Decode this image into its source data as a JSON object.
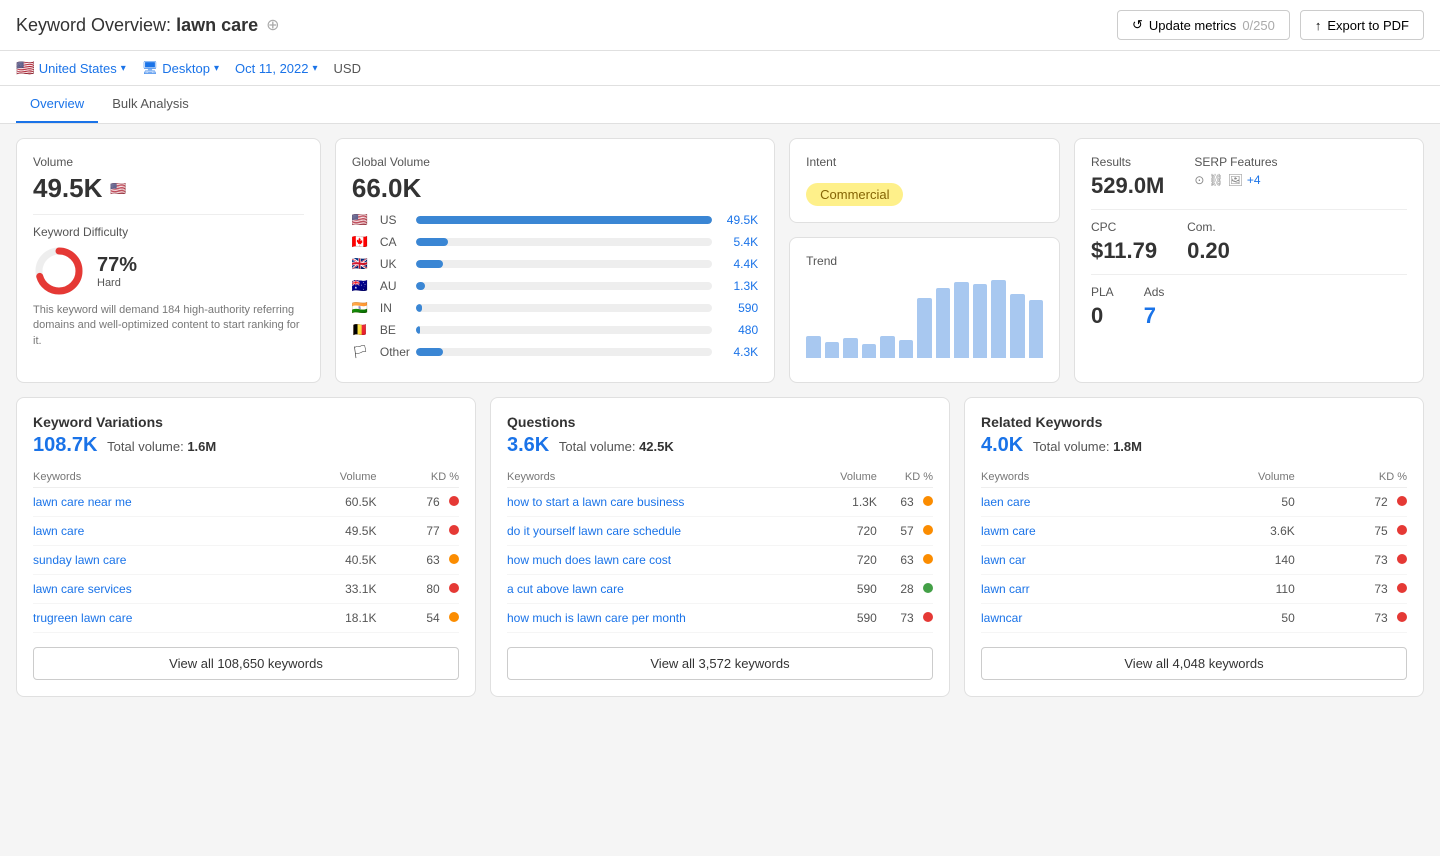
{
  "header": {
    "title": "Keyword Overview:",
    "keyword": "lawn care",
    "update_btn": "Update metrics",
    "update_count": "0/250",
    "export_btn": "Export to PDF"
  },
  "filters": {
    "country": "United States",
    "device": "Desktop",
    "date": "Oct 11, 2022",
    "currency": "USD"
  },
  "tabs": [
    {
      "label": "Overview",
      "active": true
    },
    {
      "label": "Bulk Analysis",
      "active": false
    }
  ],
  "volume_card": {
    "label": "Volume",
    "value": "49.5K",
    "kd_label": "Keyword Difficulty",
    "kd_percent": "77%",
    "kd_level": "Hard",
    "kd_desc": "This keyword will demand 184 high-authority referring domains and well-optimized content to start ranking for it."
  },
  "global_volume_card": {
    "label": "Global Volume",
    "value": "66.0K",
    "countries": [
      {
        "flag": "🇺🇸",
        "code": "US",
        "bar_pct": 100,
        "val": "49.5K"
      },
      {
        "flag": "🇨🇦",
        "code": "CA",
        "bar_pct": 11,
        "val": "5.4K"
      },
      {
        "flag": "🇬🇧",
        "code": "UK",
        "bar_pct": 9,
        "val": "4.4K"
      },
      {
        "flag": "🇦🇺",
        "code": "AU",
        "bar_pct": 3,
        "val": "1.3K"
      },
      {
        "flag": "🇮🇳",
        "code": "IN",
        "bar_pct": 2,
        "val": "590"
      },
      {
        "flag": "🇧🇪",
        "code": "BE",
        "bar_pct": 1.5,
        "val": "480"
      },
      {
        "flag": "🏳",
        "code": "Other",
        "bar_pct": 9,
        "val": "4.3K"
      }
    ]
  },
  "intent_card": {
    "label": "Intent",
    "badge": "Commercial",
    "trend_label": "Trend",
    "trend_bars": [
      20,
      15,
      18,
      14,
      20,
      16,
      55,
      65,
      70,
      68,
      72,
      60,
      55
    ]
  },
  "results_card": {
    "results_label": "Results",
    "results_value": "529.0M",
    "serp_label": "SERP Features",
    "serp_icons": [
      "⊙",
      "⛓",
      "🖼",
      "+4"
    ],
    "cpc_label": "CPC",
    "cpc_value": "$11.79",
    "com_label": "Com.",
    "com_value": "0.20",
    "pla_label": "PLA",
    "pla_value": "0",
    "ads_label": "Ads",
    "ads_value": "7"
  },
  "kw_variations": {
    "title": "Keyword Variations",
    "count": "108.7K",
    "total_label": "Total volume:",
    "total_value": "1.6M",
    "col_keywords": "Keywords",
    "col_volume": "Volume",
    "col_kd": "KD %",
    "rows": [
      {
        "kw": "lawn care near me",
        "vol": "60.5K",
        "kd": 76,
        "dot": "red"
      },
      {
        "kw": "lawn care",
        "vol": "49.5K",
        "kd": 77,
        "dot": "red"
      },
      {
        "kw": "sunday lawn care",
        "vol": "40.5K",
        "kd": 63,
        "dot": "orange"
      },
      {
        "kw": "lawn care services",
        "vol": "33.1K",
        "kd": 80,
        "dot": "red"
      },
      {
        "kw": "trugreen lawn care",
        "vol": "18.1K",
        "kd": 54,
        "dot": "orange"
      }
    ],
    "view_all": "View all 108,650 keywords"
  },
  "questions": {
    "title": "Questions",
    "count": "3.6K",
    "total_label": "Total volume:",
    "total_value": "42.5K",
    "col_keywords": "Keywords",
    "col_volume": "Volume",
    "col_kd": "KD %",
    "rows": [
      {
        "kw": "how to start a lawn care business",
        "vol": "1.3K",
        "kd": 63,
        "dot": "orange"
      },
      {
        "kw": "do it yourself lawn care schedule",
        "vol": "720",
        "kd": 57,
        "dot": "orange"
      },
      {
        "kw": "how much does lawn care cost",
        "vol": "720",
        "kd": 63,
        "dot": "orange"
      },
      {
        "kw": "a cut above lawn care",
        "vol": "590",
        "kd": 28,
        "dot": "green"
      },
      {
        "kw": "how much is lawn care per month",
        "vol": "590",
        "kd": 73,
        "dot": "red"
      }
    ],
    "view_all": "View all 3,572 keywords"
  },
  "related_keywords": {
    "title": "Related Keywords",
    "count": "4.0K",
    "total_label": "Total volume:",
    "total_value": "1.8M",
    "col_keywords": "Keywords",
    "col_volume": "Volume",
    "col_kd": "KD %",
    "rows": [
      {
        "kw": "laen care",
        "vol": "50",
        "kd": 72,
        "dot": "red"
      },
      {
        "kw": "lawm care",
        "vol": "3.6K",
        "kd": 75,
        "dot": "red"
      },
      {
        "kw": "lawn car",
        "vol": "140",
        "kd": 73,
        "dot": "red"
      },
      {
        "kw": "lawn carr",
        "vol": "110",
        "kd": 73,
        "dot": "red"
      },
      {
        "kw": "lawncar",
        "vol": "50",
        "kd": 73,
        "dot": "red"
      }
    ],
    "view_all": "View all 4,048 keywords"
  }
}
